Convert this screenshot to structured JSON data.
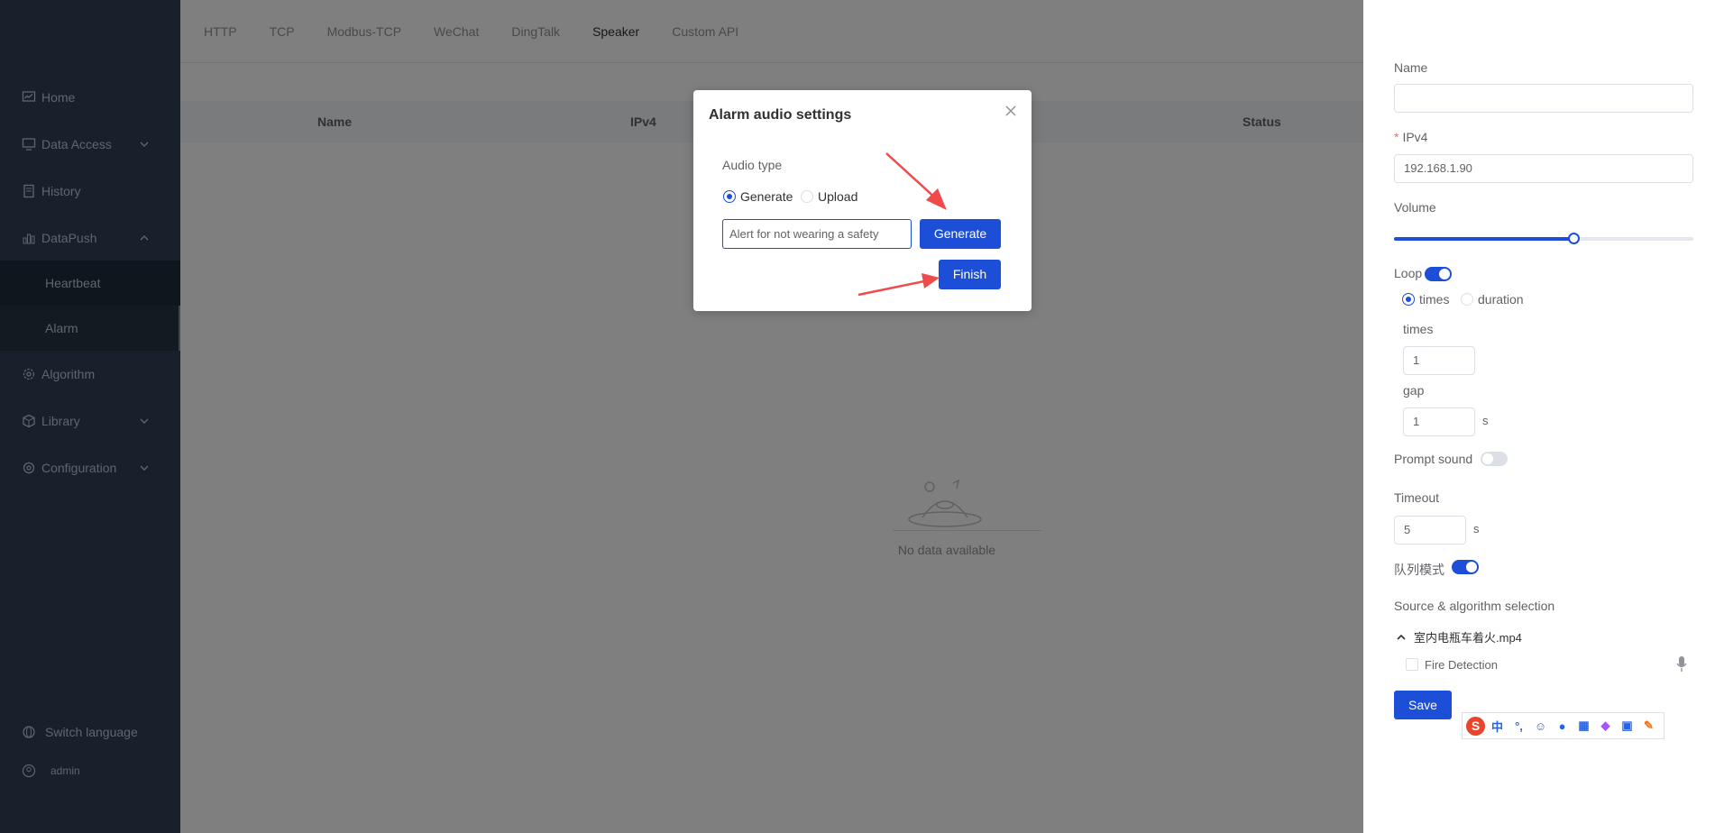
{
  "sidebar": {
    "items": [
      {
        "label": "Home"
      },
      {
        "label": "Data Access"
      },
      {
        "label": "History"
      },
      {
        "label": "DataPush"
      },
      {
        "label": "Heartbeat"
      },
      {
        "label": "Alarm"
      },
      {
        "label": "Algorithm"
      },
      {
        "label": "Library"
      },
      {
        "label": "Configuration"
      }
    ],
    "switch_language": "Switch language",
    "user": "admin"
  },
  "tabs": [
    "HTTP",
    "TCP",
    "Modbus-TCP",
    "WeChat",
    "DingTalk",
    "Speaker",
    "Custom API"
  ],
  "table": {
    "headers": {
      "name": "Name",
      "ipv4": "IPv4",
      "status": "Status"
    },
    "empty_text": "No data available"
  },
  "panel": {
    "name_label": "Name",
    "name_value": "",
    "ipv4_label": "IPv4",
    "ipv4_value": "192.168.1.90",
    "volume_label": "Volume",
    "volume_percent": 60,
    "loop_label": "Loop",
    "loop_on": true,
    "times_option": "times",
    "duration_option": "duration",
    "times_label": "times",
    "times_value": "1",
    "gap_label": "gap",
    "gap_value": "1",
    "gap_unit": "s",
    "prompt_sound_label": "Prompt sound",
    "timeout_label": "Timeout",
    "timeout_value": "5",
    "timeout_unit": "s",
    "queue_label": "队列模式",
    "source_label": "Source & algorithm selection",
    "source_file": "室内电瓶车着火.mp4",
    "algorithm": "Fire Detection",
    "save_label": "Save"
  },
  "dialog": {
    "title": "Alarm audio settings",
    "audio_type_label": "Audio type",
    "option_generate": "Generate",
    "option_upload": "Upload",
    "text_value": "Alert for not wearing a safety",
    "generate_btn": "Generate",
    "finish_btn": "Finish"
  },
  "ime": {
    "chinese": "中",
    "punct": "°,"
  },
  "colors": {
    "sidebar_bg": "#304156",
    "primary": "#1d4ed8",
    "annotation_arrow": "#f04a4a"
  }
}
